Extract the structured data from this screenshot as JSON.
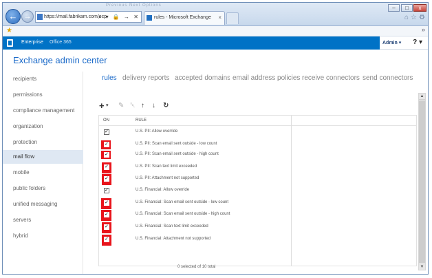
{
  "browser": {
    "url": "https://mail.fabrikam.com/ecp",
    "url_tools": "⌕ ▾ 🔒 → ✕",
    "tab_title": "rules - Microsoft Exchange",
    "tab_close": "×",
    "faded_menu": "Previous  Next  Options",
    "window_controls": {
      "minimize": "–",
      "maximize": "□",
      "close": "x"
    },
    "back_glyph": "←",
    "forward_glyph": "→",
    "icons": {
      "home": "home-icon",
      "favorites": "star-icon",
      "tools": "gear-icon"
    },
    "home_glyph": "⌂",
    "star_glyph": "☆",
    "gear_glyph": "⚙",
    "fav_glyph": "★",
    "fav_chevron": "»"
  },
  "suite_bar": {
    "enterprise": "Enterprise",
    "office365": "Office 365",
    "admin": "Admin ▾",
    "help": "? ▾",
    "color": "#0072c6"
  },
  "app_title": "Exchange admin center",
  "left_nav": [
    {
      "label": "recipients",
      "selected": false
    },
    {
      "label": "permissions",
      "selected": false
    },
    {
      "label": "compliance management",
      "selected": false
    },
    {
      "label": "organization",
      "selected": false
    },
    {
      "label": "protection",
      "selected": false
    },
    {
      "label": "mail flow",
      "selected": true
    },
    {
      "label": "mobile",
      "selected": false
    },
    {
      "label": "public folders",
      "selected": false
    },
    {
      "label": "unified messaging",
      "selected": false
    },
    {
      "label": "servers",
      "selected": false
    },
    {
      "label": "hybrid",
      "selected": false
    }
  ],
  "tabs": [
    {
      "label": "rules",
      "active": true
    },
    {
      "label": "delivery reports",
      "active": false
    },
    {
      "label": "accepted domains",
      "active": false
    },
    {
      "label": "email address policies",
      "active": false
    },
    {
      "label": "receive connectors",
      "active": false
    },
    {
      "label": "send connectors",
      "active": false
    }
  ],
  "toolbar": {
    "add": "+",
    "add_dropdown": "▾",
    "edit": "✎",
    "delete": "␡",
    "move_up": "↑",
    "move_down": "↓",
    "refresh": "↻"
  },
  "grid": {
    "columns": {
      "on": "ON",
      "rule": "RULE"
    },
    "check_glyph": "✓",
    "rows": [
      {
        "rule": "U.S. PII: Allow override",
        "on": true,
        "highlighted": false
      },
      {
        "rule": "U.S. PII: Scan email sent outside - low count",
        "on": true,
        "highlighted": true
      },
      {
        "rule": "U.S. PII: Scan email sent outside - high count",
        "on": true,
        "highlighted": true
      },
      {
        "rule": "U.S. PII: Scan text limit exceeded",
        "on": true,
        "highlighted": true
      },
      {
        "rule": "U.S. PII: Attachment not supported",
        "on": true,
        "highlighted": true
      },
      {
        "rule": "U.S. Financial: Allow override",
        "on": true,
        "highlighted": false
      },
      {
        "rule": "U.S. Financial: Scan email sent outside - low count",
        "on": true,
        "highlighted": true
      },
      {
        "rule": "U.S. Financial: Scan email sent outside - high count",
        "on": true,
        "highlighted": true
      },
      {
        "rule": "U.S. Financial: Scan text limit exceeded",
        "on": true,
        "highlighted": true
      },
      {
        "rule": "U.S. Financial: Attachment not supported",
        "on": true,
        "highlighted": true
      }
    ],
    "footer": "0 selected of 10 total"
  },
  "scroll": {
    "up": "▲",
    "down": "▼"
  },
  "highlight_color": "#e8141b"
}
